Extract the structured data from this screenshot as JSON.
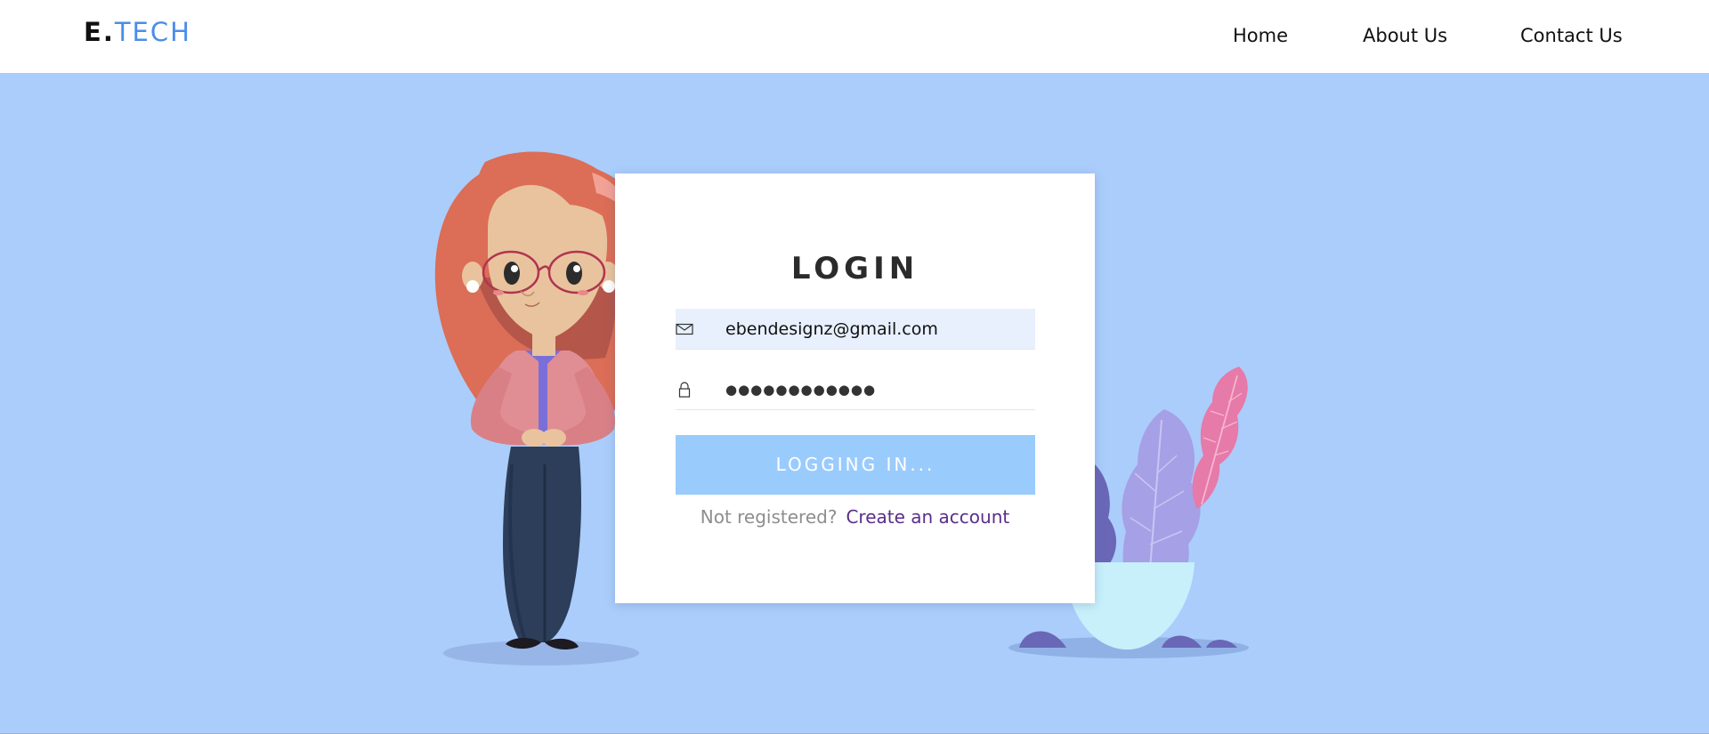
{
  "brand": {
    "logo_e": "E",
    "logo_dot": ".",
    "logo_tech": "TECH",
    "accent_color": "#4a8ee8"
  },
  "nav": {
    "items": [
      {
        "label": "Home"
      },
      {
        "label": "About Us"
      },
      {
        "label": "Contact Us"
      }
    ]
  },
  "hero": {
    "background_color": "#abcdfb"
  },
  "login": {
    "title": "LOGIN",
    "email": {
      "value": "ebendesignz@gmail.com",
      "icon": "envelope-icon"
    },
    "password": {
      "value": "●●●●●●●●●●●●",
      "icon": "lock-icon"
    },
    "submit_label": "LOGGING IN...",
    "not_registered": "Not registered?",
    "create_account": "Create an account",
    "button_color": "#9acbfd",
    "link_color": "#5b2d8a"
  },
  "illustrations": {
    "left": "woman-character-illustration",
    "right": "potted-plant-illustration"
  }
}
